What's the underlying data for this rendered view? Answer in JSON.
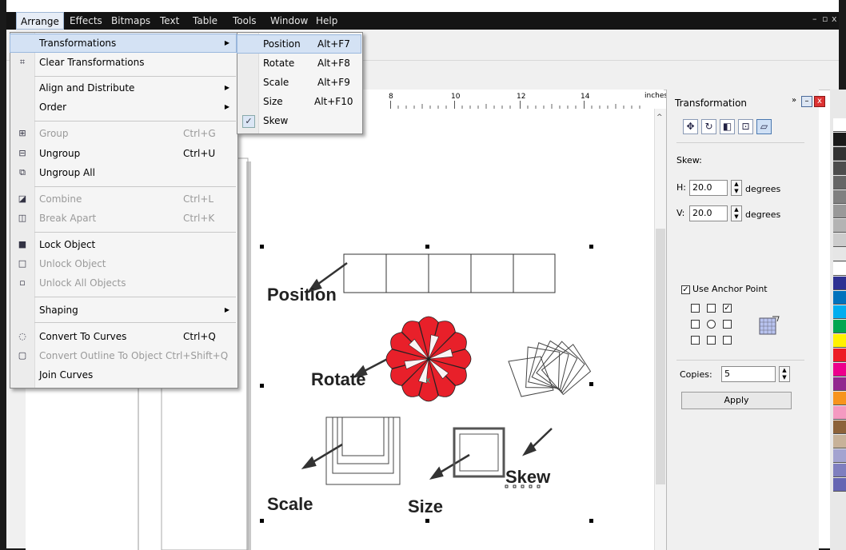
{
  "menubar": {
    "items": [
      "Arrange",
      "Effects",
      "Bitmaps",
      "Text",
      "Table",
      "Tools",
      "Window",
      "Help"
    ],
    "active": "Arrange"
  },
  "arrange_menu": {
    "items": [
      {
        "label": "Transformations",
        "shortcut": "",
        "submenu": true,
        "disabled": false,
        "highlighted": true
      },
      {
        "label": "Clear Transformations",
        "shortcut": "",
        "submenu": false,
        "disabled": false
      },
      {
        "label": "Align and Distribute",
        "shortcut": "",
        "submenu": true,
        "disabled": false
      },
      {
        "label": "Order",
        "shortcut": "",
        "submenu": true,
        "disabled": false
      },
      {
        "label": "Group",
        "shortcut": "Ctrl+G",
        "submenu": false,
        "disabled": true
      },
      {
        "label": "Ungroup",
        "shortcut": "Ctrl+U",
        "submenu": false,
        "disabled": false
      },
      {
        "label": "Ungroup All",
        "shortcut": "",
        "submenu": false,
        "disabled": false
      },
      {
        "label": "Combine",
        "shortcut": "Ctrl+L",
        "submenu": false,
        "disabled": true
      },
      {
        "label": "Break Apart",
        "shortcut": "Ctrl+K",
        "submenu": false,
        "disabled": true
      },
      {
        "label": "Lock Object",
        "shortcut": "",
        "submenu": false,
        "disabled": false
      },
      {
        "label": "Unlock Object",
        "shortcut": "",
        "submenu": false,
        "disabled": true
      },
      {
        "label": "Unlock All Objects",
        "shortcut": "",
        "submenu": false,
        "disabled": true
      },
      {
        "label": "Shaping",
        "shortcut": "",
        "submenu": true,
        "disabled": false
      },
      {
        "label": "Convert To Curves",
        "shortcut": "Ctrl+Q",
        "submenu": false,
        "disabled": false
      },
      {
        "label": "Convert Outline To Object",
        "shortcut": "Ctrl+Shift+Q",
        "submenu": false,
        "disabled": true
      },
      {
        "label": "Join Curves",
        "shortcut": "",
        "submenu": false,
        "disabled": false
      }
    ]
  },
  "transform_submenu": {
    "items": [
      {
        "label": "Position",
        "shortcut": "Alt+F7",
        "checked": false,
        "highlighted": true
      },
      {
        "label": "Rotate",
        "shortcut": "Alt+F8",
        "checked": false
      },
      {
        "label": "Scale",
        "shortcut": "Alt+F9",
        "checked": false
      },
      {
        "label": "Size",
        "shortcut": "Alt+F10",
        "checked": false
      },
      {
        "label": "Skew",
        "shortcut": "",
        "checked": true
      }
    ]
  },
  "ruler": {
    "numbers": [
      "8",
      "10",
      "12",
      "14"
    ],
    "unit": "inches"
  },
  "docker": {
    "title": "Transformation",
    "section": "Skew:",
    "h_label": "H:",
    "h_value": "20.0",
    "v_label": "V:",
    "v_value": "20.0",
    "units": "degrees",
    "anchor_label": "Use Anchor Point",
    "anchor_checked": true,
    "copies_label": "Copies:",
    "copies_value": "5",
    "apply_label": "Apply"
  },
  "canvas_labels": {
    "position": "Position",
    "rotate": "Rotate",
    "scale": "Scale",
    "size": "Size",
    "skew": "Skew"
  },
  "palette_colors": [
    "#ffffff",
    "#1a1a1a",
    "#333333",
    "#4d4d4d",
    "#666666",
    "#808080",
    "#999999",
    "#b3b3b3",
    "#cccccc",
    "#e6e6e6",
    "#ffffff",
    "#2e3192",
    "#0072bc",
    "#00aeef",
    "#00a651",
    "#fff200",
    "#ed1c24",
    "#ec008c",
    "#92278f",
    "#f7941d",
    "#f49ac1",
    "#8c6239",
    "#c7b299",
    "#a3a3d0",
    "#7f7fbf",
    "#6666b3"
  ],
  "accent": "#e8202a"
}
